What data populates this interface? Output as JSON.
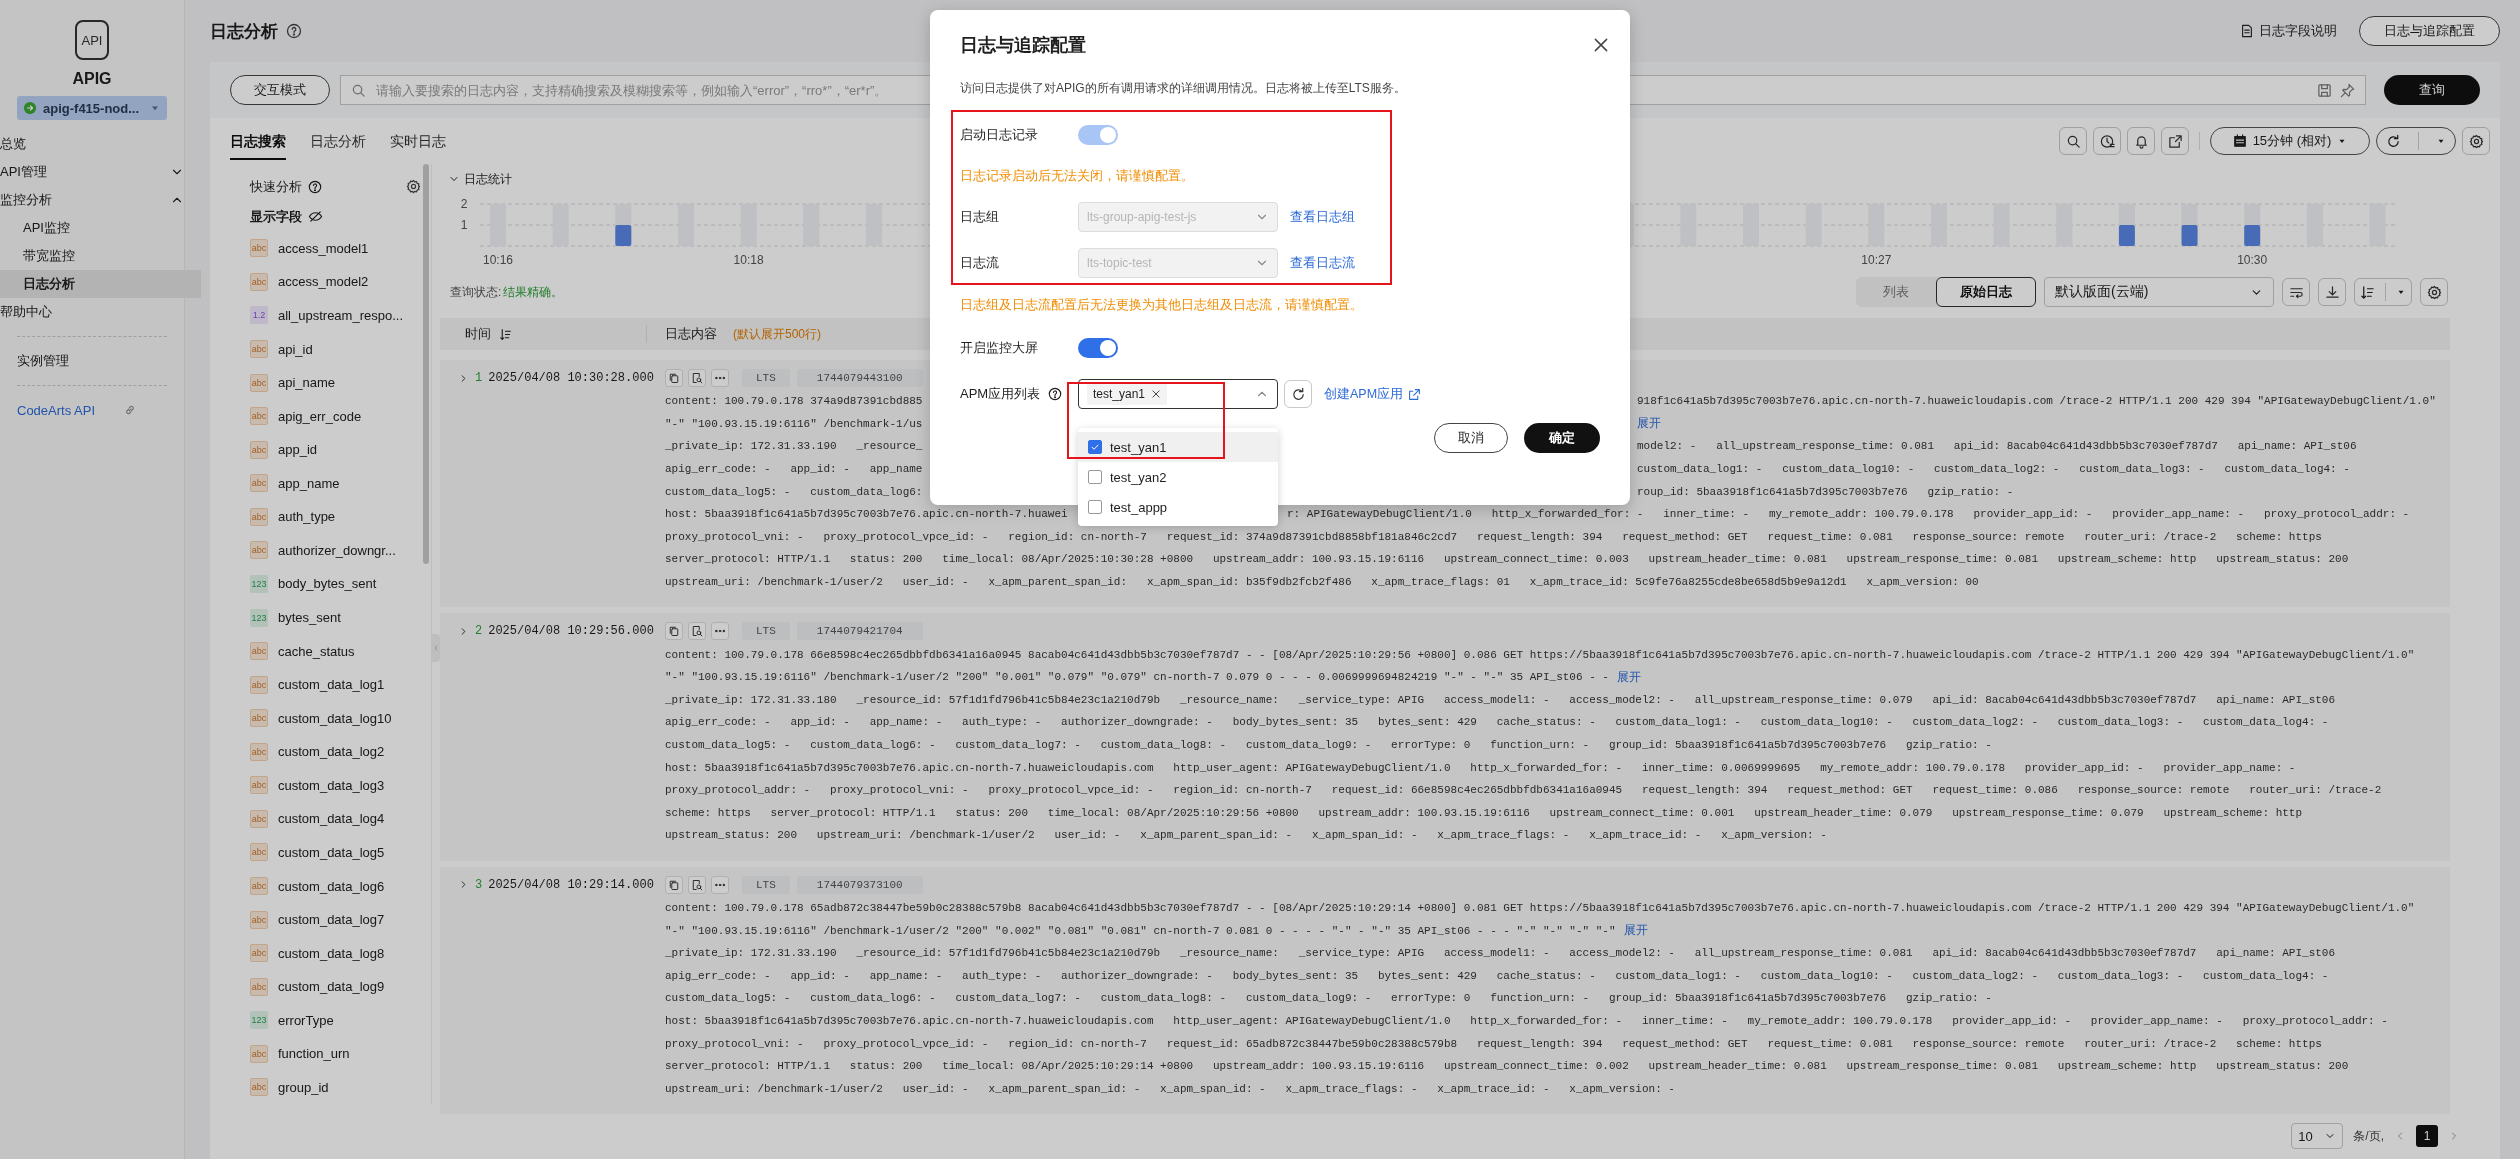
{
  "sidebar": {
    "logo_text": "API",
    "product": "APIG",
    "instance": "apig-f415-nod...",
    "sections": [
      [
        {
          "label": "总览",
          "kind": "item",
          "selected": false
        },
        {
          "label": "API管理",
          "kind": "group",
          "expanded": false,
          "selected": false
        },
        {
          "label": "监控分析",
          "kind": "group",
          "expanded": true,
          "selected": false,
          "children": [
            {
              "label": "API监控",
              "kind": "item",
              "selected": false
            },
            {
              "label": "带宽监控",
              "kind": "item",
              "selected": false
            },
            {
              "label": "日志分析",
              "kind": "item",
              "selected": true
            }
          ]
        },
        {
          "label": "帮助中心",
          "kind": "item",
          "selected": false
        }
      ],
      [
        {
          "label": "实例管理",
          "kind": "item",
          "selected": false
        }
      ],
      [
        {
          "label": "CodeArts API",
          "kind": "external",
          "selected": false
        }
      ]
    ]
  },
  "header": {
    "title": "日志分析",
    "field_doc": "日志字段说明",
    "config_button": "日志与追踪配置"
  },
  "search": {
    "mode_button": "交互模式",
    "placeholder": "请输入要搜索的日志内容，支持精确搜索及模糊搜索等，例如输入“error”，“rro*”，“er*r”。",
    "query_button": "查询"
  },
  "tabs": [
    {
      "label": "日志搜索",
      "selected": true
    },
    {
      "label": "日志分析",
      "selected": false
    },
    {
      "label": "实时日志",
      "selected": false
    }
  ],
  "toolbar": {
    "time_range": "15分钟 (相对)"
  },
  "fields_panel": {
    "title": "快速分析",
    "subtitle": "显示字段",
    "fields": [
      {
        "name": "access_model1",
        "kind": "string",
        "badge": "abc"
      },
      {
        "name": "access_model2",
        "kind": "string",
        "badge": "abc"
      },
      {
        "name": "all_upstream_respo...",
        "kind": "float",
        "badge": "1.2"
      },
      {
        "name": "api_id",
        "kind": "string",
        "badge": "abc"
      },
      {
        "name": "api_name",
        "kind": "string",
        "badge": "abc"
      },
      {
        "name": "apig_err_code",
        "kind": "string",
        "badge": "abc"
      },
      {
        "name": "app_id",
        "kind": "string",
        "badge": "abc"
      },
      {
        "name": "app_name",
        "kind": "string",
        "badge": "abc"
      },
      {
        "name": "auth_type",
        "kind": "string",
        "badge": "abc"
      },
      {
        "name": "authorizer_downgr...",
        "kind": "string",
        "badge": "abc"
      },
      {
        "name": "body_bytes_sent",
        "kind": "int",
        "badge": "123"
      },
      {
        "name": "bytes_sent",
        "kind": "int",
        "badge": "123"
      },
      {
        "name": "cache_status",
        "kind": "string",
        "badge": "abc"
      },
      {
        "name": "custom_data_log1",
        "kind": "string",
        "badge": "abc"
      },
      {
        "name": "custom_data_log10",
        "kind": "string",
        "badge": "abc"
      },
      {
        "name": "custom_data_log2",
        "kind": "string",
        "badge": "abc"
      },
      {
        "name": "custom_data_log3",
        "kind": "string",
        "badge": "abc"
      },
      {
        "name": "custom_data_log4",
        "kind": "string",
        "badge": "abc"
      },
      {
        "name": "custom_data_log5",
        "kind": "string",
        "badge": "abc"
      },
      {
        "name": "custom_data_log6",
        "kind": "string",
        "badge": "abc"
      },
      {
        "name": "custom_data_log7",
        "kind": "string",
        "badge": "abc"
      },
      {
        "name": "custom_data_log8",
        "kind": "string",
        "badge": "abc"
      },
      {
        "name": "custom_data_log9",
        "kind": "string",
        "badge": "abc"
      },
      {
        "name": "errorType",
        "kind": "int",
        "badge": "123"
      },
      {
        "name": "function_urn",
        "kind": "string",
        "badge": "abc"
      },
      {
        "name": "group_id",
        "kind": "string",
        "badge": "abc"
      }
    ]
  },
  "stats": {
    "title": "日志统计",
    "expanded": true,
    "y_labels": [
      "2",
      "1"
    ],
    "time_labels": [
      "10:16",
      "10:18",
      "10:27",
      "10:30"
    ]
  },
  "query_status": {
    "label": "查询状态:",
    "value": "结果精确。"
  },
  "view": {
    "modes": [
      {
        "label": "列表",
        "selected": false
      },
      {
        "label": "原始日志",
        "selected": true
      }
    ],
    "layout": "默认版面(云端)"
  },
  "table": {
    "columns": [
      {
        "label": "时间"
      },
      {
        "label": "日志内容",
        "note": "(默认展开500行)"
      }
    ],
    "rows": [
      {
        "index": "1",
        "time": "2025/04/08 10:30:28.000",
        "source": "LTS",
        "timestamp": "1744079443100",
        "lines": [
          {
            "kind": "dialog_gap",
            "parts": [
              "content: 100.79.0.178 374a9d87391cbd885",
              "918f1c641a5b7d395c7003b7e76.apic.cn-north-7.huaweicloudapis.com /trace-2 HTTP/1.1 200 429 394 \"APIGatewayDebugClient/1.0\""
            ]
          },
          {
            "kind": "dialog_gap",
            "parts": [
              "\"-\" \"100.93.15.19:6116\" /benchmark-1/us"
            ],
            "more": "展开"
          },
          {
            "kind": "dialog_gap",
            "parts": [
              "_private_ip: 172.31.33.190   _resource_",
              "model2: -   all_upstream_response_time: 0.081   api_id: 8acab04c641d43dbb5b3c7030ef787d7   api_name: API_st06"
            ]
          },
          {
            "kind": "dialog_gap",
            "parts": [
              "apig_err_code: -   app_id: -   app_name",
              "custom_data_log1: -   custom_data_log10: -   custom_data_log2: -   custom_data_log3: -   custom_data_log4: -"
            ]
          },
          {
            "kind": "dialog_gap",
            "parts": [
              "custom_data_log5: -   custom_data_log6:",
              "roup_id: 5baa3918f1c641a5b7d395c7003b7e76   gzip_ratio: -"
            ]
          },
          {
            "kind": "menu_gap",
            "parts": [
              "host: 5baa3918f1c641a5b7d395c7003b7e76.apic.cn-north-7.huawei",
              "r: APIGatewayDebugClient/1.0   http_x_forwarded_for: -   inner_time: -   my_remote_addr: 100.79.0.178   provider_app_id: -   provider_app_name: -   proxy_protocol_addr: -"
            ]
          },
          {
            "kind": "plain",
            "parts": [
              "proxy_protocol_vni: -   proxy_protocol_vpce_id: -   region_id: cn-north-7   request_id: 374a9d87391cbd8858bf181a846c2cd7   request_length: 394   request_method: GET   request_time: 0.081   response_source: remote   router_uri: /trace-2   scheme: https"
            ]
          },
          {
            "kind": "plain",
            "parts": [
              "server_protocol: HTTP/1.1   status: 200   time_local: 08/Apr/2025:10:30:28 +0800   upstream_addr: 100.93.15.19:6116   upstream_connect_time: 0.003   upstream_header_time: 0.081   upstream_response_time: 0.081   upstream_scheme: http   upstream_status: 200"
            ]
          },
          {
            "kind": "plain",
            "parts": [
              "upstream_uri: /benchmark-1/user/2   user_id: -   x_apm_parent_span_id:   x_apm_span_id: b35f9db2fcb2f486   x_apm_trace_flags: 01   x_apm_trace_id: 5c9fe76a8255cde8be658d5b9e9a12d1   x_apm_version: 00"
            ]
          }
        ]
      },
      {
        "index": "2",
        "time": "2025/04/08 10:29:56.000",
        "source": "LTS",
        "timestamp": "1744079421704",
        "lines": [
          {
            "parts": [
              "content: 100.79.0.178 66e8598c4ec265dbbfdb6341a16a0945 8acab04c641d43dbb5b3c7030ef787d7 - - [08/Apr/2025:10:29:56 +0800] 0.086 GET https://5baa3918f1c641a5b7d395c7003b7e76.apic.cn-north-7.huaweicloudapis.com /trace-2 HTTP/1.1 200 429 394 \"APIGatewayDebugClient/1.0\""
            ]
          },
          {
            "parts": [
              "\"-\" \"100.93.15.19:6116\" /benchmark-1/user/2 \"200\" \"0.001\" \"0.079\" \"0.079\" cn-north-7 0.079 0 - - - 0.0069999694824219 \"-\" - \"-\" 35 API_st06 - -"
            ],
            "more": "展开"
          },
          {
            "parts": [
              "_private_ip: 172.31.33.180   _resource_id: 57f1d1fd796b41c5b84e23c1a210d79b   _resource_name:   _service_type: APIG   access_model1: -   access_model2: -   all_upstream_response_time: 0.079   api_id: 8acab04c641d43dbb5b3c7030ef787d7   api_name: API_st06"
            ]
          },
          {
            "parts": [
              "apig_err_code: -   app_id: -   app_name: -   auth_type: -   authorizer_downgrade: -   body_bytes_sent: 35   bytes_sent: 429   cache_status: -   custom_data_log1: -   custom_data_log10: -   custom_data_log2: -   custom_data_log3: -   custom_data_log4: -"
            ]
          },
          {
            "parts": [
              "custom_data_log5: -   custom_data_log6: -   custom_data_log7: -   custom_data_log8: -   custom_data_log9: -   errorType: 0   function_urn: -   group_id: 5baa3918f1c641a5b7d395c7003b7e76   gzip_ratio: -"
            ]
          },
          {
            "parts": [
              "host: 5baa3918f1c641a5b7d395c7003b7e76.apic.cn-north-7.huaweicloudapis.com   http_user_agent: APIGatewayDebugClient/1.0   http_x_forwarded_for: -   inner_time: 0.0069999695   my_remote_addr: 100.79.0.178   provider_app_id: -   provider_app_name: -"
            ]
          },
          {
            "parts": [
              "proxy_protocol_addr: -   proxy_protocol_vni: -   proxy_protocol_vpce_id: -   region_id: cn-north-7   request_id: 66e8598c4ec265dbbfdb6341a16a0945   request_length: 394   request_method: GET   request_time: 0.086   response_source: remote   router_uri: /trace-2"
            ]
          },
          {
            "parts": [
              "scheme: https   server_protocol: HTTP/1.1   status: 200   time_local: 08/Apr/2025:10:29:56 +0800   upstream_addr: 100.93.15.19:6116   upstream_connect_time: 0.001   upstream_header_time: 0.079   upstream_response_time: 0.079   upstream_scheme: http"
            ]
          },
          {
            "parts": [
              "upstream_status: 200   upstream_uri: /benchmark-1/user/2   user_id: -   x_apm_parent_span_id: -   x_apm_span_id: -   x_apm_trace_flags: -   x_apm_trace_id: -   x_apm_version: -"
            ]
          }
        ]
      },
      {
        "index": "3",
        "time": "2025/04/08 10:29:14.000",
        "source": "LTS",
        "timestamp": "1744079373100",
        "lines": [
          {
            "parts": [
              "content: 100.79.0.178 65adb872c38447be59b0c28388c579b8 8acab04c641d43dbb5b3c7030ef787d7 - - [08/Apr/2025:10:29:14 +0800] 0.081 GET https://5baa3918f1c641a5b7d395c7003b7e76.apic.cn-north-7.huaweicloudapis.com /trace-2 HTTP/1.1 200 429 394 \"APIGatewayDebugClient/1.0\""
            ]
          },
          {
            "parts": [
              "\"-\" \"100.93.15.19:6116\" /benchmark-1/user/2 \"200\" \"0.002\" \"0.081\" \"0.081\" cn-north-7 0.081 0 - - - - \"-\" - \"-\" 35 API_st06 - - - \"-\" \"-\" \"-\" \"-\""
            ],
            "more": "展开"
          },
          {
            "parts": [
              "_private_ip: 172.31.33.190   _resource_id: 57f1d1fd796b41c5b84e23c1a210d79b   _resource_name:   _service_type: APIG   access_model1: -   access_model2: -   all_upstream_response_time: 0.081   api_id: 8acab04c641d43dbb5b3c7030ef787d7   api_name: API_st06"
            ]
          },
          {
            "parts": [
              "apig_err_code: -   app_id: -   app_name: -   auth_type: -   authorizer_downgrade: -   body_bytes_sent: 35   bytes_sent: 429   cache_status: -   custom_data_log1: -   custom_data_log10: -   custom_data_log2: -   custom_data_log3: -   custom_data_log4: -"
            ]
          },
          {
            "parts": [
              "custom_data_log5: -   custom_data_log6: -   custom_data_log7: -   custom_data_log8: -   custom_data_log9: -   errorType: 0   function_urn: -   group_id: 5baa3918f1c641a5b7d395c7003b7e76   gzip_ratio: -"
            ]
          },
          {
            "parts": [
              "host: 5baa3918f1c641a5b7d395c7003b7e76.apic.cn-north-7.huaweicloudapis.com   http_user_agent: APIGatewayDebugClient/1.0   http_x_forwarded_for: -   inner_time: -   my_remote_addr: 100.79.0.178   provider_app_id: -   provider_app_name: -   proxy_protocol_addr: -"
            ]
          },
          {
            "parts": [
              "proxy_protocol_vni: -   proxy_protocol_vpce_id: -   region_id: cn-north-7   request_id: 65adb872c38447be59b0c28388c579b8   request_length: 394   request_method: GET   request_time: 0.081   response_source: remote   router_uri: /trace-2   scheme: https"
            ]
          },
          {
            "parts": [
              "server_protocol: HTTP/1.1   status: 200   time_local: 08/Apr/2025:10:29:14 +0800   upstream_addr: 100.93.15.19:6116   upstream_connect_time: 0.002   upstream_header_time: 0.081   upstream_response_time: 0.081   upstream_scheme: http   upstream_status: 200"
            ]
          },
          {
            "parts": [
              "upstream_uri: /benchmark-1/user/2   user_id: -   x_apm_parent_span_id: -   x_apm_span_id: -   x_apm_trace_flags: -   x_apm_trace_id: -   x_apm_version: -"
            ]
          }
        ]
      }
    ]
  },
  "pagination": {
    "page_size": "10",
    "unit": "条/页,",
    "pages": [
      {
        "label": "1",
        "selected": true
      }
    ]
  },
  "dialog": {
    "title": "日志与追踪配置",
    "description": "访问日志提供了对APIG的所有调用请求的详细调用情况。日志将被上传至LTS服务。",
    "logging": {
      "label": "启动日志记录",
      "on": true,
      "disabled": true
    },
    "logging_warning": "日志记录启动后无法关闭，请谨慎配置。",
    "log_group": {
      "label": "日志组",
      "value": "lts-group-apig-test-js",
      "disabled": true,
      "link": "查看日志组"
    },
    "log_stream": {
      "label": "日志流",
      "value": "lts-topic-test",
      "disabled": true,
      "link": "查看日志流"
    },
    "stream_warning": "日志组及日志流配置后无法更换为其他日志组及日志流，请谨慎配置。",
    "dashboard": {
      "label": "开启监控大屏",
      "on": true,
      "disabled": false
    },
    "apm": {
      "label": "APM应用列表",
      "tags": [
        "test_yan1"
      ],
      "expanded": true,
      "link": "创建APM应用",
      "options": [
        {
          "label": "test_yan1",
          "checked": true,
          "selected": true
        },
        {
          "label": "test_yan2",
          "checked": false,
          "selected": false
        },
        {
          "label": "test_appp",
          "checked": false,
          "selected": false
        }
      ]
    },
    "buttons": [
      {
        "label": "取消",
        "kind": "secondary"
      },
      {
        "label": "确定",
        "kind": "primary"
      }
    ]
  }
}
